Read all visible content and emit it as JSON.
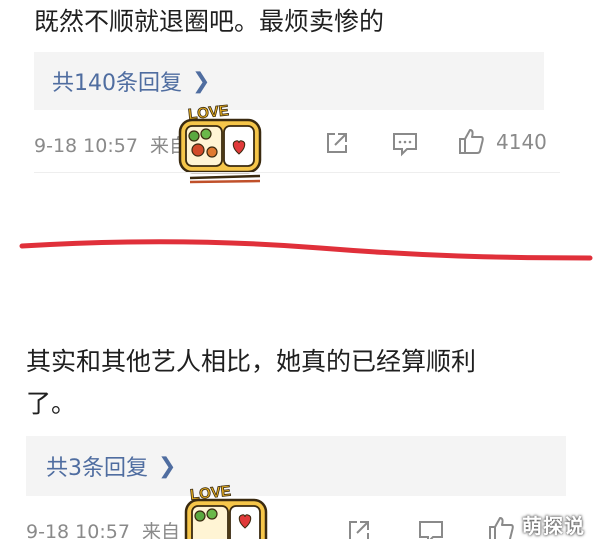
{
  "comments": [
    {
      "text": "既然不顺就退圈吧。最烦卖惨的",
      "replies_label": "共140条回复",
      "timestamp": "9-18 10:57",
      "source_prefix": "来自",
      "likes": "4140"
    },
    {
      "text_line1": "其实和其他艺人相比，她真的已经算顺利",
      "text_line2": "了。",
      "replies_label": "共3条回复",
      "timestamp": "9-18 10:57",
      "source_prefix": "来自"
    }
  ],
  "sticker_text": "LOVE",
  "watermark": "萌探说",
  "colors": {
    "link": "#4f6da0",
    "meta": "#8a8a8a",
    "divider": "#e0303a",
    "reply_bg": "#f4f4f4"
  },
  "icons": [
    "reply-link-chevron-icon",
    "share-icon",
    "comment-icon",
    "like-icon",
    "lunchbox-sticker"
  ]
}
